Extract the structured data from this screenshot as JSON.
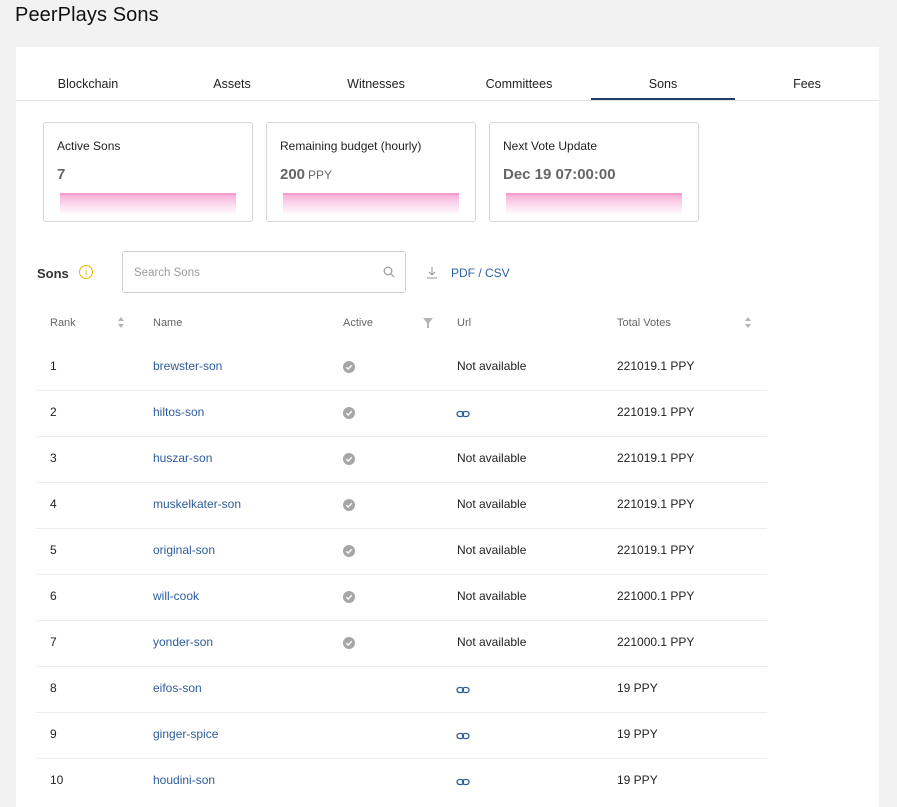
{
  "page": {
    "title": "PeerPlays Sons"
  },
  "tabs": [
    {
      "label": "Blockchain"
    },
    {
      "label": "Assets"
    },
    {
      "label": "Witnesses"
    },
    {
      "label": "Committees"
    },
    {
      "label": "Sons"
    },
    {
      "label": "Fees"
    }
  ],
  "active_tab": "Sons",
  "stats": {
    "active_sons": {
      "label": "Active Sons",
      "value": "7"
    },
    "remaining_budget": {
      "label": "Remaining budget (hourly)",
      "value": "200",
      "unit": "PPY"
    },
    "next_vote": {
      "label": "Next Vote Update",
      "value": "Dec 19 07:00:00"
    }
  },
  "sons_section": {
    "title": "Sons",
    "search_placeholder": "Search Sons",
    "export_label": "PDF / CSV"
  },
  "table": {
    "headers": {
      "rank": "Rank",
      "name": "Name",
      "active": "Active",
      "url": "Url",
      "total_votes": "Total Votes"
    },
    "rows": [
      {
        "rank": "1",
        "name": "brewster-son",
        "active": true,
        "url": "Not available",
        "has_link": false,
        "votes": "221019.1 PPY"
      },
      {
        "rank": "2",
        "name": "hiltos-son",
        "active": true,
        "url": "",
        "has_link": true,
        "votes": "221019.1 PPY"
      },
      {
        "rank": "3",
        "name": "huszar-son",
        "active": true,
        "url": "Not available",
        "has_link": false,
        "votes": "221019.1 PPY"
      },
      {
        "rank": "4",
        "name": "muskelkater-son",
        "active": true,
        "url": "Not available",
        "has_link": false,
        "votes": "221019.1 PPY"
      },
      {
        "rank": "5",
        "name": "original-son",
        "active": true,
        "url": "Not available",
        "has_link": false,
        "votes": "221019.1 PPY"
      },
      {
        "rank": "6",
        "name": "will-cook",
        "active": true,
        "url": "Not available",
        "has_link": false,
        "votes": "221000.1 PPY"
      },
      {
        "rank": "7",
        "name": "yonder-son",
        "active": true,
        "url": "Not available",
        "has_link": false,
        "votes": "221000.1 PPY"
      },
      {
        "rank": "8",
        "name": "eifos-son",
        "active": false,
        "url": "",
        "has_link": true,
        "votes": "19 PPY"
      },
      {
        "rank": "9",
        "name": "ginger-spice",
        "active": false,
        "url": "",
        "has_link": true,
        "votes": "19 PPY"
      },
      {
        "rank": "10",
        "name": "houdini-son",
        "active": false,
        "url": "",
        "has_link": true,
        "votes": "19 PPY"
      }
    ]
  },
  "colors": {
    "link": "#2d5d9c",
    "tab_underline": "#1e3f6e",
    "active_icon": "#a6a6a6",
    "info_icon": "#e6b800",
    "graph_pink": "#f6a8d6"
  }
}
